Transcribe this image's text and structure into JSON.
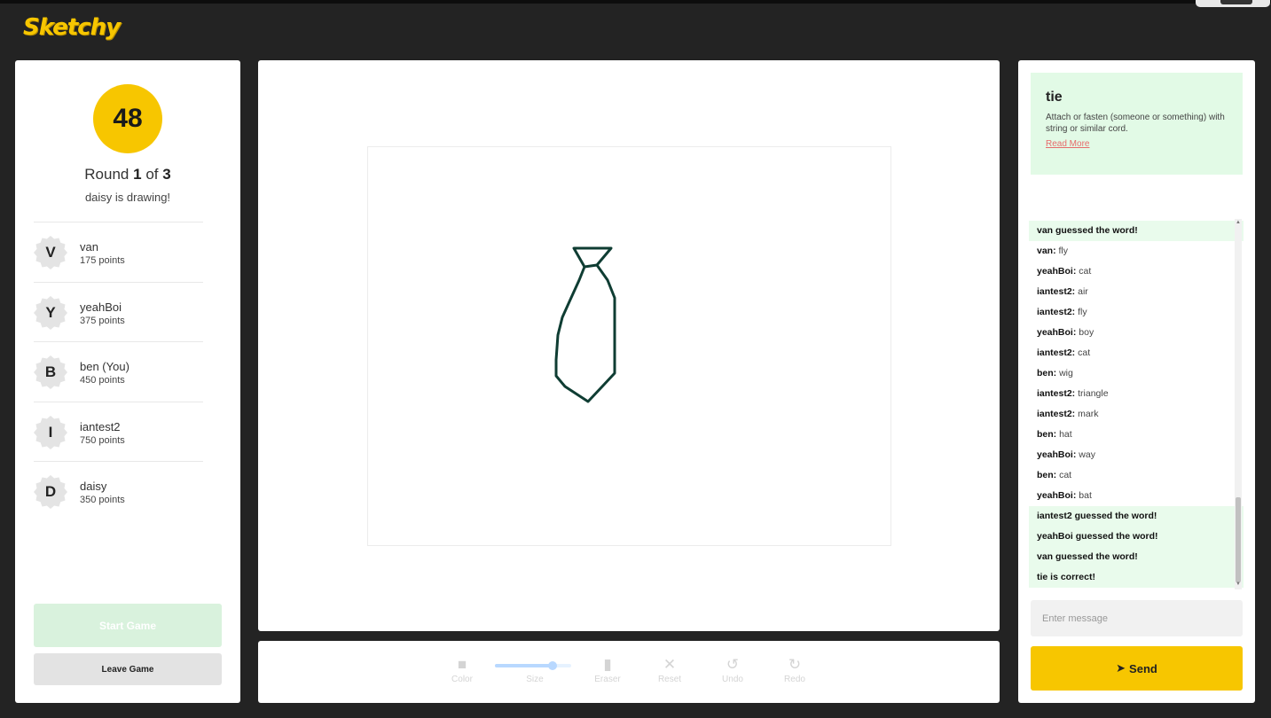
{
  "app": {
    "logo": "Sketchy"
  },
  "game": {
    "timer": "48",
    "round_prefix": "Round",
    "round_current": "1",
    "round_of": "of",
    "round_total": "3",
    "drawing_status": "daisy is drawing!"
  },
  "players": [
    {
      "initial": "V",
      "name": "van",
      "points": "175 points"
    },
    {
      "initial": "Y",
      "name": "yeahBoi",
      "points": "375 points"
    },
    {
      "initial": "B",
      "name": "ben (You)",
      "points": "450 points"
    },
    {
      "initial": "I",
      "name": "iantest2",
      "points": "750 points"
    },
    {
      "initial": "D",
      "name": "daisy",
      "points": "350 points"
    }
  ],
  "buttons": {
    "start": "Start Game",
    "leave": "Leave Game",
    "send": "Send"
  },
  "tools": {
    "color": {
      "label": "Color",
      "icon": "square-icon"
    },
    "size": {
      "label": "Size",
      "value": 0.75
    },
    "eraser": {
      "label": "Eraser",
      "icon": "eraser-icon"
    },
    "reset": {
      "label": "Reset",
      "icon": "close-icon"
    },
    "undo": {
      "label": "Undo",
      "icon": "undo-icon"
    },
    "redo": {
      "label": "Redo",
      "icon": "redo-icon"
    }
  },
  "word": {
    "title": "tie",
    "definition": "Attach or fasten (someone or something) with string or similar cord.",
    "read_more": "Read More"
  },
  "chat": [
    {
      "system": true,
      "user": "",
      "text": "van guessed the word!"
    },
    {
      "system": false,
      "user": "van:",
      "text": "fly"
    },
    {
      "system": false,
      "user": "yeahBoi:",
      "text": "cat"
    },
    {
      "system": false,
      "user": "iantest2:",
      "text": "air"
    },
    {
      "system": false,
      "user": "iantest2:",
      "text": "fly"
    },
    {
      "system": false,
      "user": "yeahBoi:",
      "text": "boy"
    },
    {
      "system": false,
      "user": "iantest2:",
      "text": "cat"
    },
    {
      "system": false,
      "user": "ben:",
      "text": "wig"
    },
    {
      "system": false,
      "user": "iantest2:",
      "text": "triangle"
    },
    {
      "system": false,
      "user": "iantest2:",
      "text": "mark"
    },
    {
      "system": false,
      "user": "ben:",
      "text": "hat"
    },
    {
      "system": false,
      "user": "yeahBoi:",
      "text": "way"
    },
    {
      "system": false,
      "user": "ben:",
      "text": "cat"
    },
    {
      "system": false,
      "user": "yeahBoi:",
      "text": "bat"
    },
    {
      "system": true,
      "user": "",
      "text": "iantest2 guessed the word!"
    },
    {
      "system": true,
      "user": "",
      "text": "yeahBoi guessed the word!"
    },
    {
      "system": true,
      "user": "",
      "text": "van guessed the word!"
    },
    {
      "system": true,
      "user": "",
      "text": "tie is correct!"
    }
  ],
  "message_input": {
    "placeholder": "Enter message",
    "value": ""
  },
  "colors": {
    "accent": "#f7c600",
    "background": "#232323",
    "success_bg": "#e2fae6",
    "stroke": "#0f3d33"
  }
}
